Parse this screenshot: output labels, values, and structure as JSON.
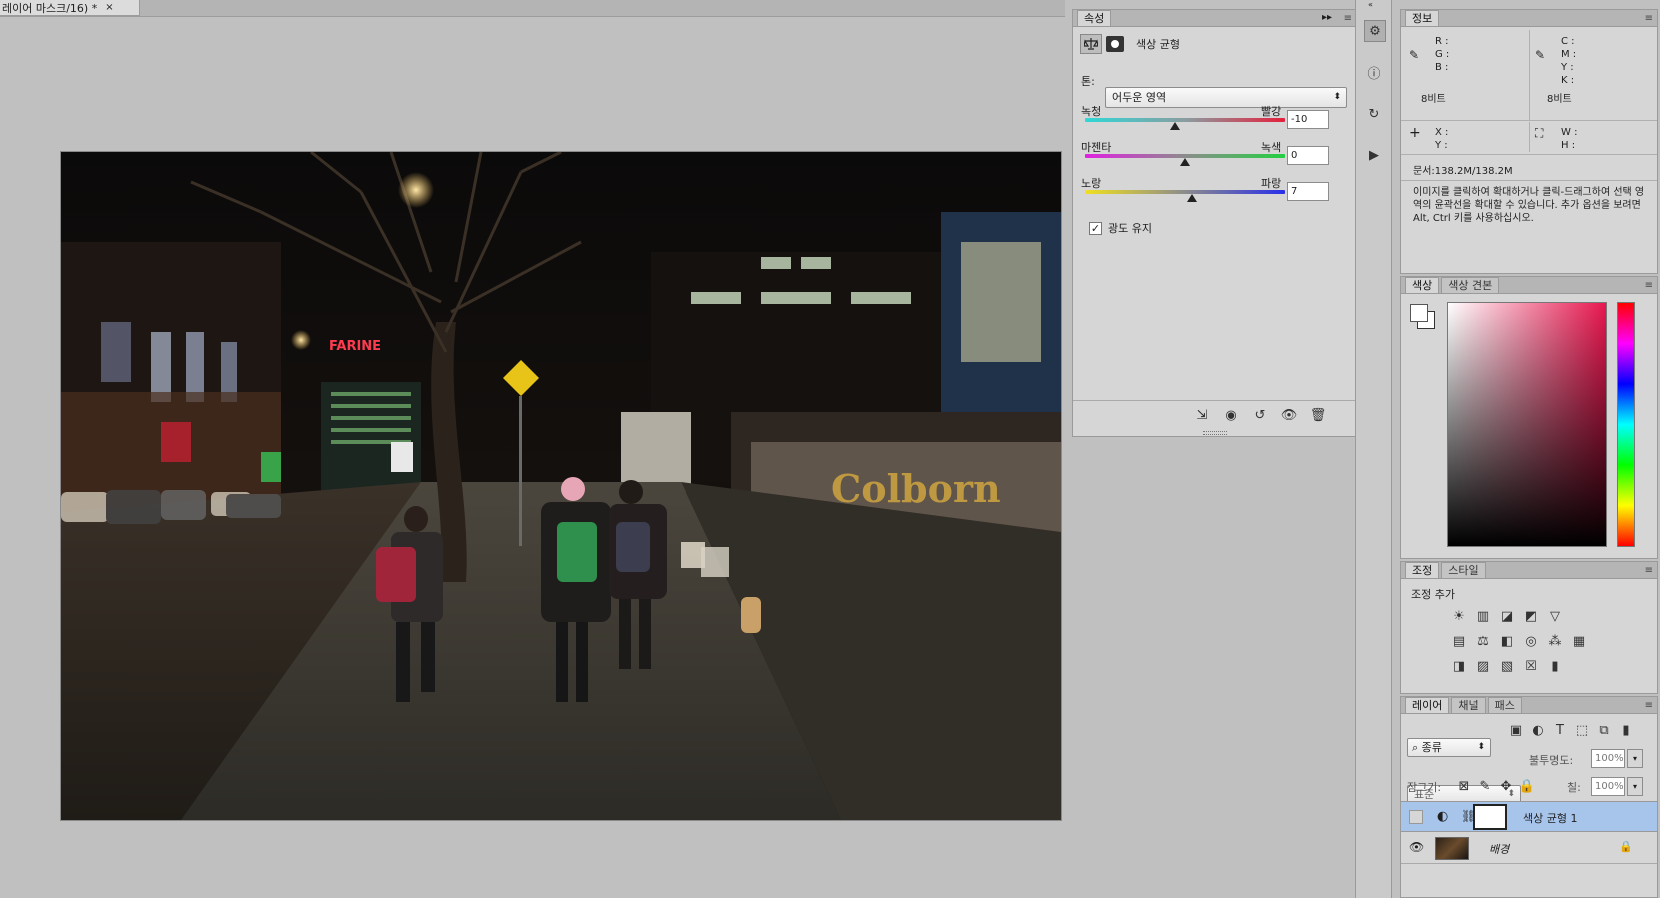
{
  "document": {
    "tab_title": "레이어 마스크/16) *",
    "close_glyph": "×"
  },
  "properties": {
    "tab_label": "속성",
    "adjustment_name": "색상 균형",
    "tone_label": "톤:",
    "tone_value": "어두운 영역",
    "sliders": [
      {
        "left": "녹청",
        "right": "빨강",
        "value": "-10",
        "level": -10
      },
      {
        "left": "마젠타",
        "right": "녹색",
        "value": "0",
        "level": 0
      },
      {
        "left": "노랑",
        "right": "파랑",
        "value": "7",
        "level": 7
      }
    ],
    "preserve_luminosity_label": "광도 유지",
    "preserve_luminosity_checked": true
  },
  "info": {
    "tab_label": "정보",
    "rgb_labels": [
      "R :",
      "G :",
      "B :"
    ],
    "cmyk_labels": [
      "C :",
      "M :",
      "Y :",
      "K :"
    ],
    "bit_left": "8비트",
    "bit_right": "8비트",
    "xy_labels": [
      "X :",
      "Y :"
    ],
    "wh_labels": [
      "W :",
      "H :"
    ],
    "doc_size": "문서:138.2M/138.2M",
    "hint": "이미지를 클릭하여 확대하거나 클릭-드래그하여 선택 영역의 윤곽선을 확대할 수 있습니다. 추가 옵션을 보려면 Alt, Ctrl 키를 사용하십시오."
  },
  "color": {
    "tabs": [
      "색상",
      "색상 견본"
    ],
    "hue": "#e8174f"
  },
  "adjustments": {
    "tabs": [
      "조정",
      "스타일"
    ],
    "add_label": "조정 추가"
  },
  "layers": {
    "tabs": [
      "레이어",
      "채널",
      "패스"
    ],
    "filter_label": "종류",
    "blend_mode": "표준",
    "opacity_label": "불투명도:",
    "opacity_value": "100%",
    "lock_label": "잠그기:",
    "fill_label": "칠:",
    "fill_value": "100%",
    "items": [
      {
        "name": "색상 균형 1",
        "selected": true
      },
      {
        "name": "배경",
        "selected": false
      }
    ]
  },
  "colors": {
    "panel": "#d6d6d6",
    "selected_layer": "#a7c4ea",
    "canvas_bg": "#c0c0c0"
  }
}
